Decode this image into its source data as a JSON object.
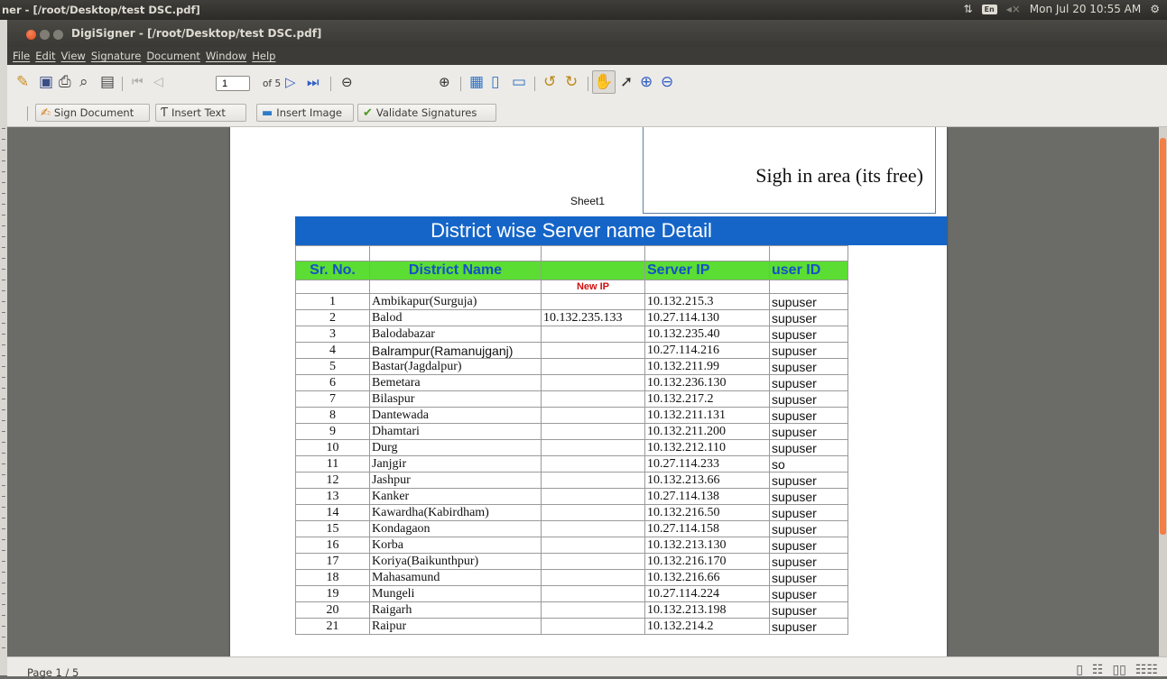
{
  "system_panel": {
    "title": "ner - [/root/Desktop/test DSC.pdf]",
    "lang": "En",
    "clock": "Mon Jul 20 10:55 AM"
  },
  "window": {
    "title": "DigiSigner - [/root/Desktop/test DSC.pdf]"
  },
  "menu": [
    "File",
    "Edit",
    "View",
    "Signature",
    "Document",
    "Window",
    "Help"
  ],
  "toolbar": {
    "page_value": "1",
    "page_of": "of 5",
    "icons": [
      "open-icon",
      "save-icon",
      "print-icon",
      "print-preview-icon",
      "properties-icon",
      "first-page-icon",
      "previous-page-icon",
      "next-page-icon",
      "last-page-icon",
      "zoom-out-circle-icon",
      "zoom-in-circle-icon",
      "fit-page-icon",
      "fit-width-icon",
      "fit-visible-icon",
      "rotate-left-icon",
      "rotate-right-icon",
      "hand-tool-icon",
      "select-tool-icon",
      "zoom-in-icon",
      "zoom-out-icon"
    ]
  },
  "toolbar2": {
    "sign_document": "Sign Document",
    "insert_text": "Insert Text",
    "insert_image": "Insert Image",
    "validate_signatures": "Validate Signatures"
  },
  "document": {
    "sign_area_text": "Sigh in area (its free)",
    "sheet_label": "Sheet1",
    "banner_title": "District wise Server name Detail",
    "headers": {
      "sr": "Sr. No.",
      "district": "District Name",
      "extra": "",
      "server_ip": "Server IP",
      "user_id": "user ID"
    },
    "new_ip_label": "New IP",
    "rows": [
      {
        "sr": "1",
        "district": "Ambikapur(Surguja)",
        "new_ip": "",
        "server_ip": "10.132.215.3",
        "user": "supuser"
      },
      {
        "sr": "2",
        "district": "Balod",
        "new_ip": "10.132.235.133",
        "server_ip": "10.27.114.130",
        "user": "supuser"
      },
      {
        "sr": "3",
        "district": "Balodabazar",
        "new_ip": "",
        "server_ip": "10.132.235.40",
        "user": "supuser"
      },
      {
        "sr": "4",
        "district": "Balrampur(Ramanujganj)",
        "new_ip": "",
        "server_ip": "10.27.114.216",
        "user": "supuser"
      },
      {
        "sr": "5",
        "district": "Bastar(Jagdalpur)",
        "new_ip": "",
        "server_ip": "10.132.211.99",
        "user": "supuser"
      },
      {
        "sr": "6",
        "district": "Bemetara",
        "new_ip": "",
        "server_ip": "10.132.236.130",
        "user": "supuser"
      },
      {
        "sr": "7",
        "district": "Bilaspur",
        "new_ip": "",
        "server_ip": "10.132.217.2",
        "user": "supuser"
      },
      {
        "sr": "8",
        "district": "Dantewada",
        "new_ip": "",
        "server_ip": "10.132.211.131",
        "user": "supuser"
      },
      {
        "sr": "9",
        "district": "Dhamtari",
        "new_ip": "",
        "server_ip": "10.132.211.200",
        "user": "supuser"
      },
      {
        "sr": "10",
        "district": "Durg",
        "new_ip": "",
        "server_ip": "10.132.212.110",
        "user": "supuser"
      },
      {
        "sr": "11",
        "district": "Janjgir",
        "new_ip": "",
        "server_ip": "10.27.114.233",
        "user": "so"
      },
      {
        "sr": "12",
        "district": "Jashpur",
        "new_ip": "",
        "server_ip": "10.132.213.66",
        "user": "supuser"
      },
      {
        "sr": "13",
        "district": "Kanker",
        "new_ip": "",
        "server_ip": "10.27.114.138",
        "user": "supuser"
      },
      {
        "sr": "14",
        "district": "Kawardha(Kabirdham)",
        "new_ip": "",
        "server_ip": "10.132.216.50",
        "user": "supuser"
      },
      {
        "sr": "15",
        "district": "Kondagaon",
        "new_ip": "",
        "server_ip": "10.27.114.158",
        "user": "supuser"
      },
      {
        "sr": "16",
        "district": "Korba",
        "new_ip": "",
        "server_ip": "10.132.213.130",
        "user": "supuser"
      },
      {
        "sr": "17",
        "district": "Koriya(Baikunthpur)",
        "new_ip": "",
        "server_ip": "10.132.216.170",
        "user": "supuser"
      },
      {
        "sr": "18",
        "district": "Mahasamund",
        "new_ip": "",
        "server_ip": "10.132.216.66",
        "user": "supuser"
      },
      {
        "sr": "19",
        "district": "Mungeli",
        "new_ip": "",
        "server_ip": "10.27.114.224",
        "user": "supuser"
      },
      {
        "sr": "20",
        "district": "Raigarh",
        "new_ip": "",
        "server_ip": "10.132.213.198",
        "user": "supuser"
      },
      {
        "sr": "21",
        "district": "Raipur",
        "new_ip": "",
        "server_ip": "10.132.214.2",
        "user": "supuser"
      }
    ]
  },
  "status": {
    "page_text": "Page 1 / 5"
  },
  "colors": {
    "accent_orange": "#f27f44",
    "banner_blue": "#1565c8",
    "header_green": "#5bdd33",
    "header_text_blue": "#1550c6",
    "new_ip_red": "#d01010"
  }
}
